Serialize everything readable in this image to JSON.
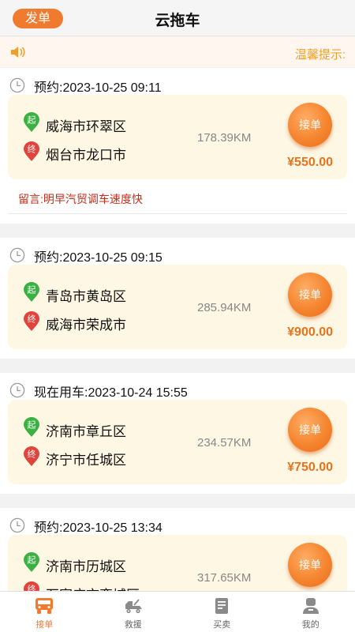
{
  "header": {
    "post_label": "发单",
    "title": "云拖车"
  },
  "notice": {
    "text": "温馨提示:"
  },
  "orders": [
    {
      "time_label": "预约:2023-10-25 09:11",
      "start_badge": "起",
      "start": "威海市环翠区",
      "end_badge": "终",
      "end": "烟台市龙口市",
      "distance": "178.39KM",
      "accept_label": "接单",
      "price": "¥550.00",
      "message": "留言:明早汽贸调车速度快"
    },
    {
      "time_label": "预约:2023-10-25 09:15",
      "start_badge": "起",
      "start": "青岛市黄岛区",
      "end_badge": "终",
      "end": "威海市荣成市",
      "distance": "285.94KM",
      "accept_label": "接单",
      "price": "¥900.00"
    },
    {
      "time_label": "现在用车:2023-10-24 15:55",
      "start_badge": "起",
      "start": "济南市章丘区",
      "end_badge": "终",
      "end": "济宁市任城区",
      "distance": "234.57KM",
      "accept_label": "接单",
      "price": "¥750.00"
    },
    {
      "time_label": "预约:2023-10-25 13:34",
      "start_badge": "起",
      "start": "济南市历城区",
      "end_badge": "终",
      "end": "石家庄市栾城区",
      "distance": "317.65KM",
      "accept_label": "接单",
      "price": ""
    }
  ],
  "tabs": [
    {
      "label": "接单",
      "icon": "truck-icon",
      "active": true
    },
    {
      "label": "救援",
      "icon": "tow-truck-icon",
      "active": false
    },
    {
      "label": "买卖",
      "icon": "document-icon",
      "active": false
    },
    {
      "label": "我的",
      "icon": "user-icon",
      "active": false
    }
  ],
  "colors": {
    "accent": "#f07a2e",
    "price": "#e8731c",
    "start_pin": "#3cb043",
    "end_pin": "#e0443c",
    "message": "#c0301c",
    "notice": "#f0a030"
  }
}
